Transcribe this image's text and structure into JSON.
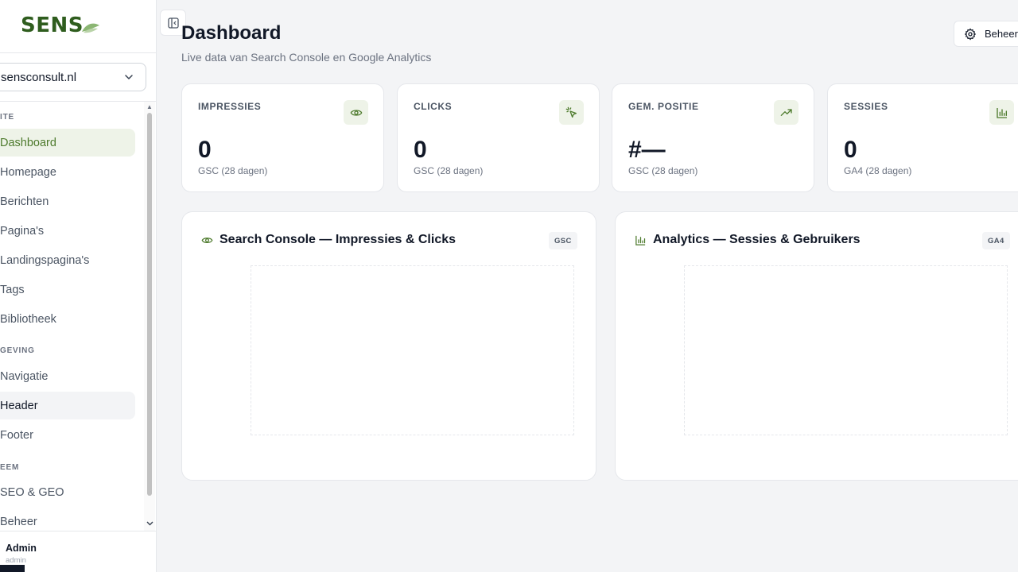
{
  "sidebar": {
    "logo": "SENS",
    "site_select": "sensconsult.nl",
    "sections": [
      {
        "label": "ITE"
      },
      {
        "label": "GEVING"
      },
      {
        "label": "EEM"
      }
    ],
    "items": [
      {
        "label": "Dashboard",
        "state": "active"
      },
      {
        "label": "Homepage"
      },
      {
        "label": "Berichten"
      },
      {
        "label": "Pagina's"
      },
      {
        "label": "Landingspagina's"
      },
      {
        "label": "Tags"
      },
      {
        "label": "Bibliotheek"
      },
      {
        "label": "Navigatie"
      },
      {
        "label": "Header",
        "state": "hover"
      },
      {
        "label": "Footer"
      },
      {
        "label": "SEO & GEO"
      },
      {
        "label": "Beheer"
      }
    ],
    "user": {
      "name": "Admin",
      "role": "admin"
    }
  },
  "header": {
    "title": "Dashboard",
    "subtitle": "Live data van Search Console en Google Analytics",
    "manage_label": "Beheer"
  },
  "kpis": [
    {
      "label": "IMPRESSIES",
      "value": "0",
      "sub": "GSC (28 dagen)",
      "icon": "eye-icon"
    },
    {
      "label": "CLICKS",
      "value": "0",
      "sub": "GSC (28 dagen)",
      "icon": "pointer-click-icon"
    },
    {
      "label": "GEM. POSITIE",
      "value": "#—",
      "sub": "GSC (28 dagen)",
      "icon": "trending-up-icon"
    },
    {
      "label": "SESSIES",
      "value": "0",
      "sub": "GA4 (28 dagen)",
      "icon": "bar-chart-icon"
    }
  ],
  "charts": [
    {
      "title": "Search Console — Impressies & Clicks",
      "badge": "GSC",
      "icon": "eye-icon"
    },
    {
      "title": "Analytics — Sessies & Gebruikers",
      "badge": "GA4",
      "icon": "bar-chart-icon"
    }
  ],
  "colors": {
    "accent": "#4d7a2c",
    "accent_bg": "#eef3e8",
    "brand": "#2f5d1e"
  }
}
